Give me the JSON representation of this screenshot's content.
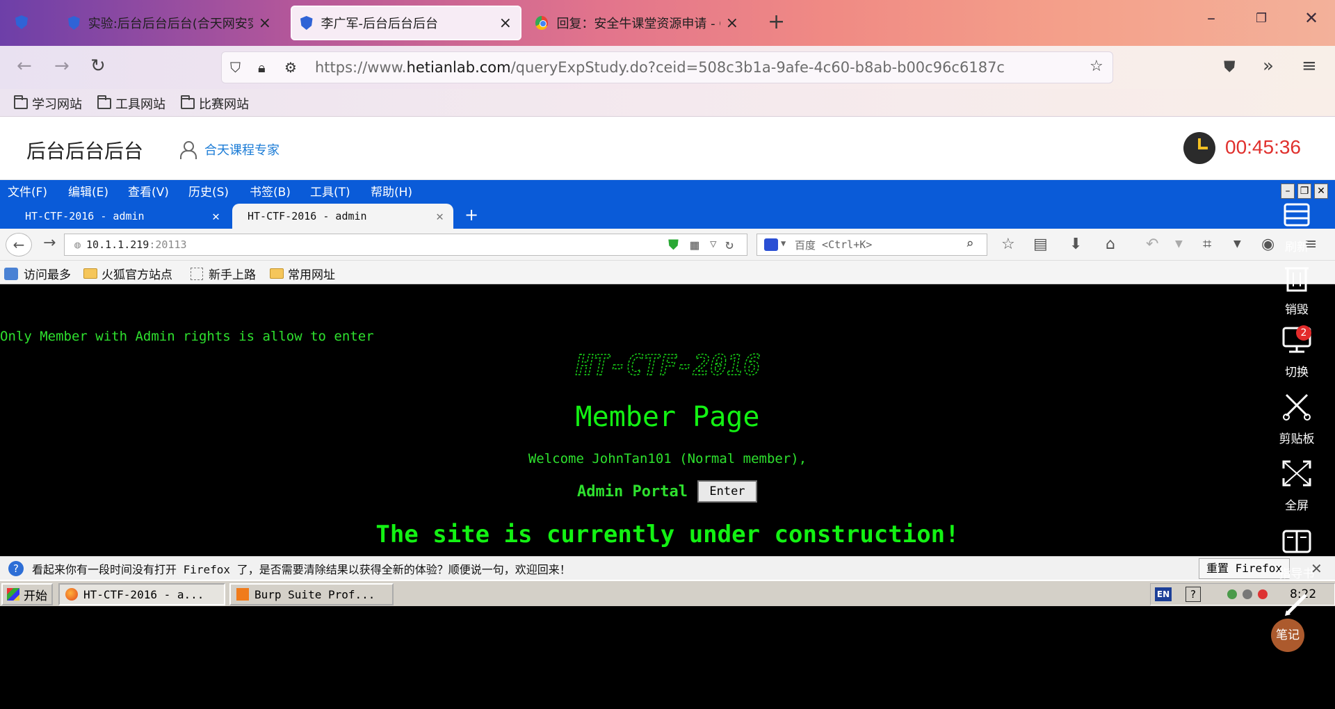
{
  "outer_browser": {
    "tabs": [
      {
        "title": "实验:后台后台后台(合天网安实验室)",
        "active": false
      },
      {
        "title": "李广军-后台后台后台",
        "active": true
      },
      {
        "title": "回复：安全牛课堂资源申请 - Q",
        "active": false
      }
    ],
    "url_prefix": "https://www.",
    "url_domain": "hetianlab.com",
    "url_rest": "/queryExpStudy.do?ceid=508c3b1a-9afe-4c60-b8ab-b00c96c6187c",
    "bookmarks": [
      "学习网站",
      "工具网站",
      "比赛网站"
    ]
  },
  "lab_header": {
    "title": "后台后台后台",
    "expert_link": "合天课程专家",
    "timer": "00:45:36"
  },
  "inner_browser": {
    "menu": [
      "文件(F)",
      "编辑(E)",
      "查看(V)",
      "历史(S)",
      "书签(B)",
      "工具(T)",
      "帮助(H)"
    ],
    "tabs": [
      {
        "title": "HT-CTF-2016 - admin",
        "active": false
      },
      {
        "title": "HT-CTF-2016 - admin",
        "active": true
      }
    ],
    "url_host": "10.1.1.219",
    "url_port": ":20113",
    "search_engine": "百度",
    "search_placeholder": "<Ctrl+K>",
    "bookmarks": [
      "访问最多",
      "火狐官方站点",
      "新手上路",
      "常用网址"
    ]
  },
  "page": {
    "notice": "Only Member with Admin rights is allow to enter",
    "title": "Member Page",
    "welcome": "Welcome JohnTan101 (Normal member),",
    "portal_label": "Admin Portal",
    "enter_button": "Enter",
    "construction": "The site is currently under construction!"
  },
  "infobar": {
    "message": "看起来你有一段时间没有打开 Firefox 了，是否需要清除结果以获得全新的体验？顺便说一句，欢迎回来！",
    "reset_button": "重置 Firefox"
  },
  "taskbar": {
    "start": "开始",
    "tasks": [
      "HT-CTF-2016 - a...",
      "Burp Suite Prof..."
    ],
    "lang": "EN",
    "time": "8:22"
  },
  "side_tools": {
    "items": [
      "刷新",
      "销毁",
      "切换",
      "剪贴板",
      "全屏",
      "指导书",
      "笔记"
    ],
    "switch_badge": "2"
  }
}
